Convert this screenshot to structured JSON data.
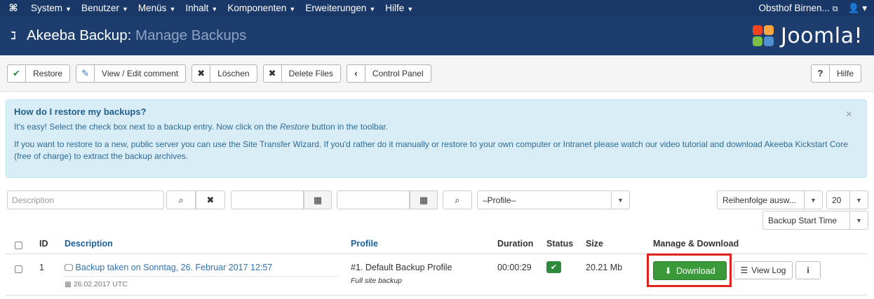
{
  "topnav": {
    "menu": [
      {
        "label": "System"
      },
      {
        "label": "Benutzer"
      },
      {
        "label": "Menüs"
      },
      {
        "label": "Inhalt"
      },
      {
        "label": "Komponenten"
      },
      {
        "label": "Erweiterungen"
      },
      {
        "label": "Hilfe"
      }
    ],
    "site_name": "Obsthof Birnen..."
  },
  "header": {
    "title_main": "Akeeba Backup:",
    "title_sub": "Manage Backups",
    "brand": "Joomla!"
  },
  "toolbar": {
    "restore": "Restore",
    "view_edit": "View / Edit comment",
    "delete": "Löschen",
    "delete_files": "Delete Files",
    "control_panel": "Control Panel",
    "help": "Hilfe"
  },
  "alert": {
    "heading": "How do I restore my backups?",
    "line1_pre": "It's easy! Select the check box next to a backup entry. Now click on the ",
    "line1_em": "Restore",
    "line1_post": " button in the toolbar.",
    "line2": "If you want to restore to a new, public server you can use the Site Transfer Wizard. If you'd rather do it manually or restore to your own computer or Intranet please watch our video tutorial and download Akeeba Kickstart Core (free of charge) to extract the backup archives."
  },
  "filters": {
    "description_placeholder": "Description",
    "profile_select": "–Profile–",
    "order_select": "Reihenfolge ausw...",
    "limit_select": "20",
    "sort_select": "Backup Start Time"
  },
  "table": {
    "headers": {
      "id": "ID",
      "description": "Description",
      "profile": "Profile",
      "duration": "Duration",
      "status": "Status",
      "size": "Size",
      "manage": "Manage & Download"
    },
    "rows": [
      {
        "id": "1",
        "description": "Backup taken on Sonntag, 26. Februar 2017 12:57",
        "date": "26.02.2017 UTC",
        "profile": "#1. Default Backup Profile",
        "profile_type": "Full site backup",
        "duration": "00:00:29",
        "size": "20.21 Mb",
        "download": "Download",
        "view_log": "View Log"
      }
    ]
  }
}
